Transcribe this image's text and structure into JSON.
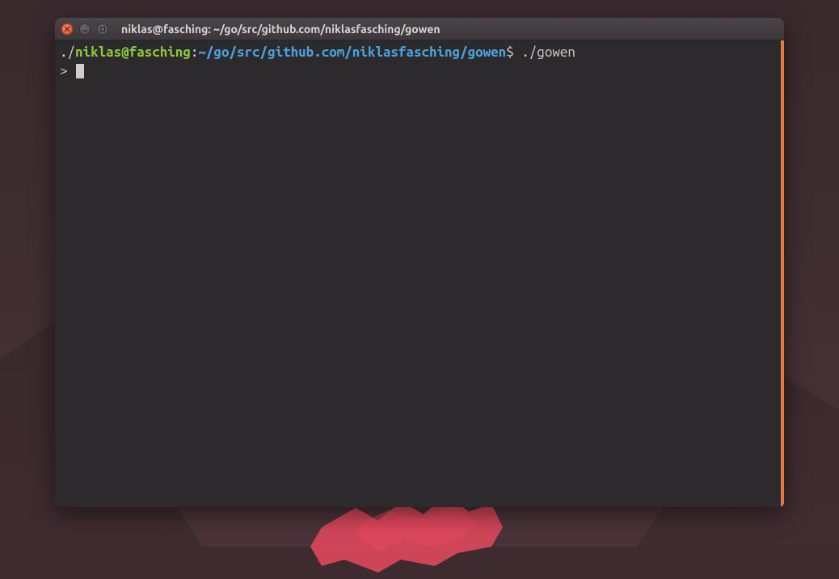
{
  "titlebar": {
    "title": "niklas@fasching: ~/go/src/github.com/niklasfasching/gowen"
  },
  "prompt": {
    "prefix": "./",
    "user_host": "niklas@fasching",
    "separator": ":",
    "cwd": "~/go/src/github.com/niklasfasching/gowen",
    "symbol": "$",
    "command": " ./gowen"
  },
  "output": {
    "repl_prompt": "> "
  }
}
